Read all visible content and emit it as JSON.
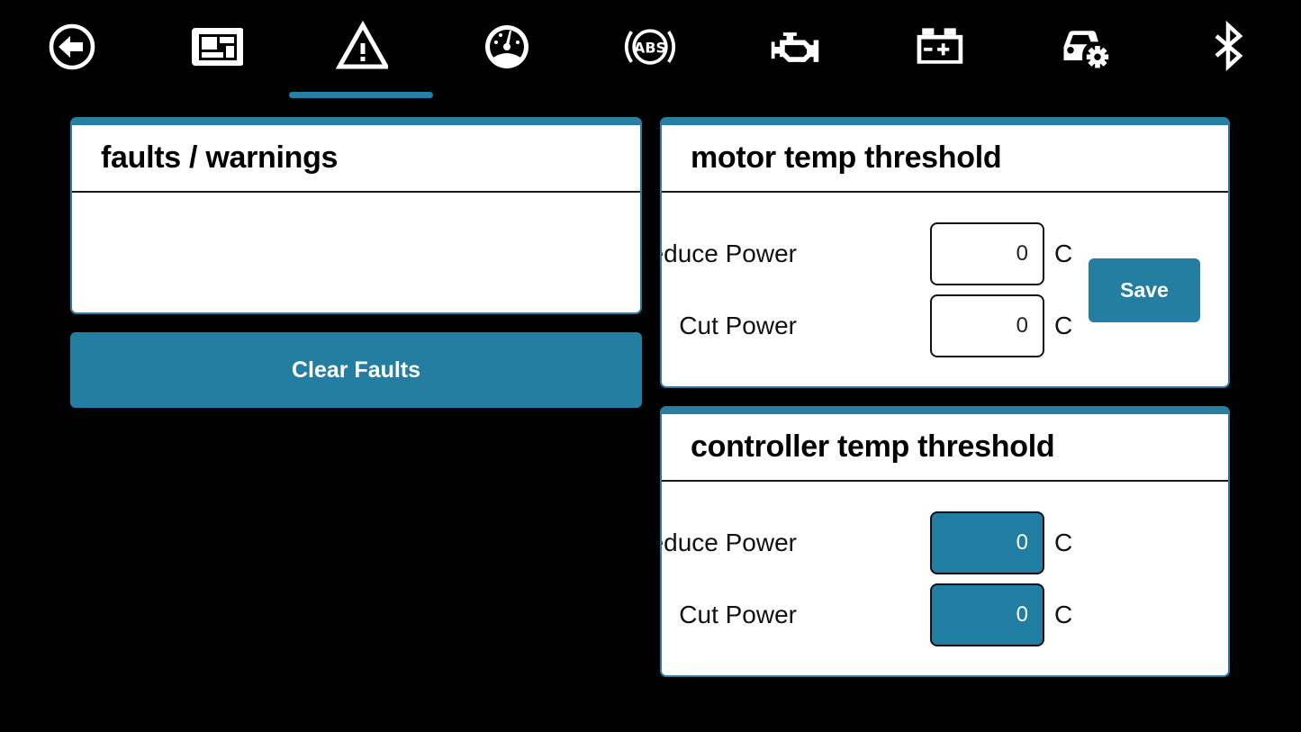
{
  "nav": {
    "items": [
      {
        "id": "back",
        "icon": "back-arrow-circle-icon"
      },
      {
        "id": "dashboard",
        "icon": "dashboard-layout-icon"
      },
      {
        "id": "warnings",
        "icon": "warning-triangle-icon",
        "active": true
      },
      {
        "id": "gauge",
        "icon": "speedometer-icon"
      },
      {
        "id": "abs",
        "icon": "abs-icon",
        "text": "ABS"
      },
      {
        "id": "engine",
        "icon": "engine-icon"
      },
      {
        "id": "battery",
        "icon": "battery-icon"
      },
      {
        "id": "vehicle-settings",
        "icon": "car-gear-icon"
      },
      {
        "id": "bluetooth",
        "icon": "bluetooth-icon"
      }
    ],
    "accent_color": "#2580a5"
  },
  "faults": {
    "title": "faults / warnings",
    "items": [],
    "clear_button_label": "Clear Faults"
  },
  "motor": {
    "title": "motor temp threshold",
    "reduce_label": "Reduce Power",
    "reduce_value": "0",
    "cut_label": "Cut Power",
    "cut_value": "0",
    "unit": "C",
    "save_label": "Save"
  },
  "controller": {
    "title": "controller temp threshold",
    "reduce_label": "Reduce Power",
    "reduce_value": "0",
    "cut_label": "Cut Power",
    "cut_value": "0",
    "unit": "C"
  }
}
